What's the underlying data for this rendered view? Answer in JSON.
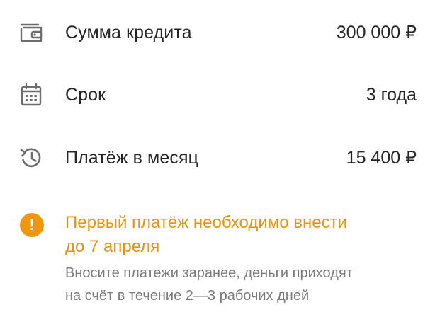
{
  "rows": [
    {
      "icon": "wallet-icon",
      "label": "Сумма кредита",
      "value": "300 000 ₽"
    },
    {
      "icon": "calendar-icon",
      "label": "Срок",
      "value": "3 года"
    },
    {
      "icon": "history-icon",
      "label": "Платёж в месяц",
      "value": "15 400 ₽"
    }
  ],
  "notice": {
    "icon": "exclamation-icon",
    "icon_glyph": "!",
    "title_line1": "Первый платёж необходимо внести",
    "title_line2": "до 7 апреля",
    "text_line1": "Вносите платежи заранее, деньги приходят",
    "text_line2": "на счёт в течение 2—3 рабочих дней",
    "accent_color": "#F0960F"
  }
}
